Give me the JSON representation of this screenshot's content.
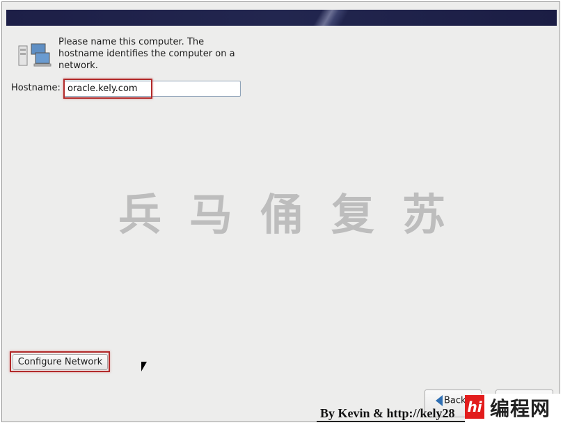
{
  "description": "Please name this computer.  The hostname identifies the computer on a network.",
  "hostname": {
    "label": "Hostname:",
    "value": "oracle.kely.com"
  },
  "watermark": [
    "兵",
    "马",
    "俑",
    "复",
    "苏"
  ],
  "buttons": {
    "configure_network": "Configure Network",
    "back": "Back",
    "next": ""
  },
  "credit": "By Kevin & http://kely28",
  "logo": {
    "mark": "hi",
    "text": "编程网"
  },
  "colors": {
    "banner": "#1d1f47",
    "highlight": "#b22a2a",
    "background": "#ededec"
  }
}
